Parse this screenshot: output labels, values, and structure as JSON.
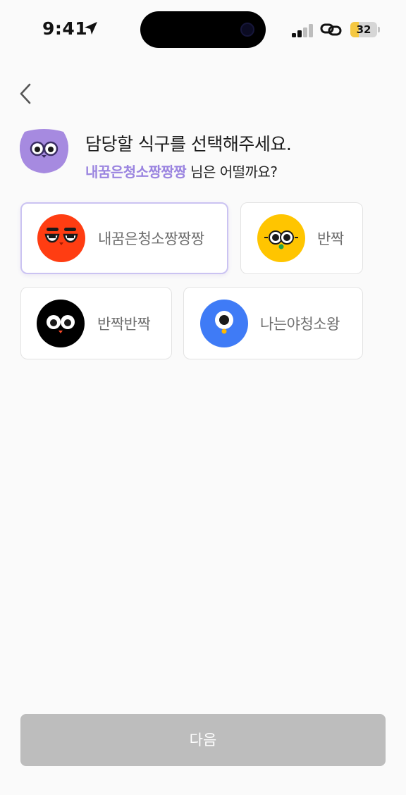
{
  "status_bar": {
    "time": "9:41",
    "battery_level": 32,
    "battery_text": "32",
    "icons": [
      "location-arrow-icon",
      "signal-icon",
      "link-icon",
      "battery-icon"
    ]
  },
  "nav": {
    "back_icon": "chevron-left-icon"
  },
  "header": {
    "title": "담당할 식구를 선택해주세요.",
    "subtitle_name": "내꿈은청소짱짱짱",
    "subtitle_rest": " 님은 어떨까요?",
    "avatar_color": "#a68ae0"
  },
  "members": [
    {
      "name": "내꿈은청소짱짱짱",
      "color": "#ff3d12",
      "selected": true
    },
    {
      "name": "반짝",
      "color": "#ffc500",
      "selected": false
    },
    {
      "name": "반짝반짝",
      "color": "#000000",
      "selected": false
    },
    {
      "name": "나는야청소왕",
      "color": "#3f7bf6",
      "selected": false
    }
  ],
  "footer": {
    "next_label": "다음",
    "next_color": "#bdbdbd"
  },
  "colors": {
    "accent": "#9b85e0",
    "background": "#fafafa"
  }
}
